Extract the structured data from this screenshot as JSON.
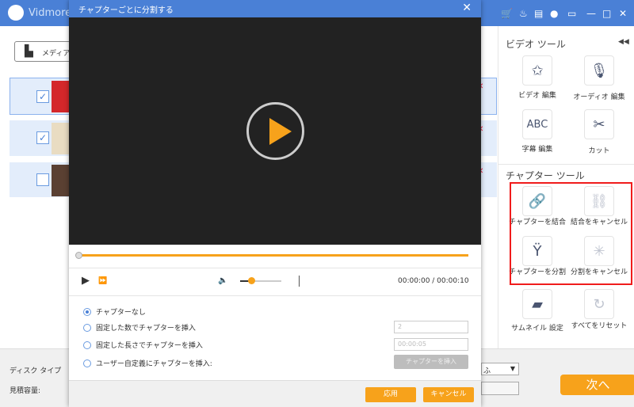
{
  "app": {
    "title": "Vidmore I",
    "icons": [
      "cart-icon",
      "key-icon",
      "register-icon",
      "chat-icon",
      "feedback-icon",
      "minimize-icon",
      "maximize-icon",
      "close-icon"
    ]
  },
  "left": {
    "add_media": "メディア"
  },
  "bottom": {
    "disc_type_label": "ディスク タイプ",
    "size_label": "見積容量:",
    "disc_select_value": "ふ",
    "next": "次へ"
  },
  "right": {
    "video_tools_title": "ビデオ ツール",
    "video_tools": [
      {
        "label": "ビデオ 編集",
        "icon": "magic-wand-icon"
      },
      {
        "label": "オーディオ 編集",
        "icon": "microphone-icon"
      },
      {
        "label": "字幕 編集",
        "icon": "abc-icon",
        "glyph": "ABC"
      },
      {
        "label": "カット",
        "icon": "scissors-icon"
      }
    ],
    "chapter_tools_title": "チャプター ツール",
    "chapter_tools": [
      {
        "label": "チャプターを結合",
        "icon": "link-icon",
        "enabled": true
      },
      {
        "label": "結合をキャンセル",
        "icon": "unlink-icon",
        "enabled": false
      },
      {
        "label": "チャプターを分割",
        "icon": "split-icon",
        "enabled": true
      },
      {
        "label": "分割をキャンセル",
        "icon": "cancel-split-icon",
        "enabled": false
      }
    ],
    "other_tools": [
      {
        "label": "サムネイル 設定",
        "icon": "thumbnail-icon"
      },
      {
        "label": "すべてをリセット",
        "icon": "reset-icon"
      }
    ]
  },
  "dialog": {
    "title": "チャプターごとに分割する",
    "time": "00:00:00 / 00:00:10",
    "playback_progress": 0,
    "volume_level": 0.25,
    "options": [
      {
        "label": "チャプターなし",
        "selected": true
      },
      {
        "label": "固定した数でチャプターを挿入",
        "selected": false
      },
      {
        "label": "固定した長さでチャプターを挿入",
        "selected": false
      },
      {
        "label": "ユーザー自定義にチャプターを挿入:",
        "selected": false
      }
    ],
    "count_value": "2",
    "length_value": "00:00:05",
    "insert_button": "チャプターを挿入",
    "apply": "応用",
    "cancel": "キャンセル"
  },
  "colors": {
    "accent": "#f7a21b",
    "titlebar": "#4a80d6",
    "highlight": "#f01c1c"
  }
}
